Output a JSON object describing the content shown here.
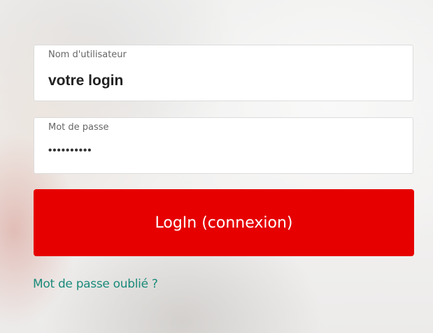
{
  "login_form": {
    "username": {
      "label": "Nom d'utilisateur",
      "value": "votre login"
    },
    "password": {
      "label": "Mot de passe",
      "value": "••••••••••"
    },
    "submit_label": "LogIn (connexion)",
    "forgot_password_label": "Mot de passe oublié ?"
  },
  "colors": {
    "primary_button": "#e60000",
    "link": "#1a8a7a"
  }
}
